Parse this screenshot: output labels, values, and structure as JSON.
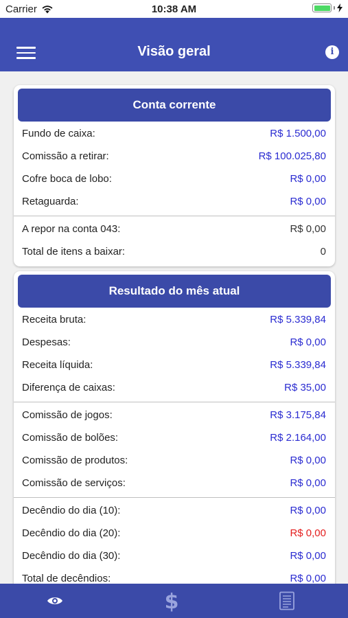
{
  "status_bar": {
    "carrier": "Carrier",
    "time": "10:38 AM",
    "icons": [
      "wifi-icon",
      "battery-icon",
      "charging-bolt-icon"
    ]
  },
  "header": {
    "title": "Visão geral",
    "menu_icon": "hamburger-menu-icon",
    "info_icon": "info-icon",
    "info_glyph": "i"
  },
  "colors": {
    "nav": "#3f4fb3",
    "card_header": "#3b4aa8",
    "value_blue": "#2a2bd1",
    "value_red": "#e41e1e"
  },
  "conta_corrente": {
    "title": "Conta corrente",
    "rows": [
      {
        "label": "Fundo de caixa:",
        "value": "R$ 1.500,00"
      },
      {
        "label": "Comissão a retirar:",
        "value": "R$ 100.025,80"
      },
      {
        "label": "Cofre boca de lobo:",
        "value": "R$ 0,00"
      },
      {
        "label": "Retaguarda:",
        "value": "R$ 0,00"
      },
      {
        "label": "A repor na conta 043:",
        "value": "R$ 0,00"
      },
      {
        "label": "Total de itens a baixar:",
        "value": "0"
      }
    ]
  },
  "resultado": {
    "title": "Resultado do mês atual",
    "rows": [
      {
        "label": "Receita bruta:",
        "value": "R$ 5.339,84"
      },
      {
        "label": "Despesas:",
        "value": "R$ 0,00"
      },
      {
        "label": "Receita líquida:",
        "value": "R$ 5.339,84"
      },
      {
        "label": "Diferença de caixas:",
        "value": "R$ 35,00"
      },
      {
        "label": "Comissão de jogos:",
        "value": "R$ 3.175,84"
      },
      {
        "label": "Comissão de bolões:",
        "value": "R$ 2.164,00"
      },
      {
        "label": "Comissão de produtos:",
        "value": "R$ 0,00"
      },
      {
        "label": "Comissão de serviços:",
        "value": "R$ 0,00"
      },
      {
        "label": "Decêndio do dia (10):",
        "value": "R$ 0,00"
      },
      {
        "label": "Decêndio do dia (20):",
        "value": "R$ 0,00"
      },
      {
        "label": "Decêndio do dia (30):",
        "value": "R$ 0,00"
      },
      {
        "label": "Total de decêndios:",
        "value": "R$ 0,00"
      }
    ]
  },
  "tab_bar": {
    "tabs": [
      {
        "icon": "eye-icon",
        "selected": true
      },
      {
        "icon": "dollar-sign-icon",
        "selected": false
      },
      {
        "icon": "document-icon",
        "selected": false
      }
    ]
  }
}
